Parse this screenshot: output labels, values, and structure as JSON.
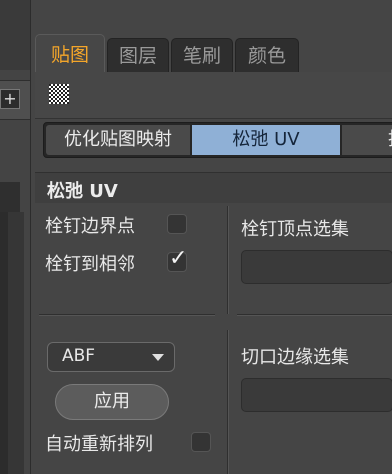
{
  "tabs": [
    {
      "label": "贴图",
      "active": true
    },
    {
      "label": "图层",
      "active": false
    },
    {
      "label": "笔刷",
      "active": false
    },
    {
      "label": "颜色",
      "active": false
    }
  ],
  "left_panel": {
    "add_label": "+"
  },
  "mode_bar": {
    "optimize_label": "优化贴图映射",
    "relax_label": "松弛 UV",
    "third_label": "投"
  },
  "section": {
    "title": "松弛 UV"
  },
  "options": {
    "pin_border_label": "栓钉边界点",
    "pin_border_checked": false,
    "pin_neighbor_label": "栓钉到相邻",
    "pin_neighbor_checked": true,
    "pin_vertex_selection_label": "栓钉顶点选集",
    "cut_edge_selection_label": "切口边缘选集",
    "auto_rearrange_label": "自动重新排列",
    "auto_rearrange_checked": false
  },
  "method": {
    "selected": "ABF"
  },
  "apply_label": "应用",
  "colors": {
    "active_tab_text": "#f4a62a",
    "selected_mode_bg": "#8fb0d6"
  }
}
